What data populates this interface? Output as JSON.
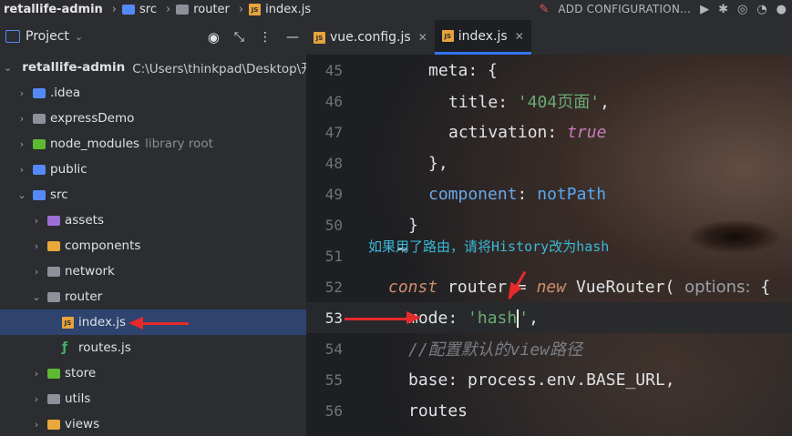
{
  "breadcrumb": {
    "project": "retallife-admin",
    "src": "src",
    "router": "router",
    "file": "index.js"
  },
  "toolbar": {
    "add_configuration": "ADD CONFIGURATION..."
  },
  "project_panel": {
    "title": "Project",
    "root": {
      "name": "retallife-admin",
      "path": "C:\\Users\\thinkpad\\Desktop\\开源"
    },
    "items": [
      {
        "name": ".idea"
      },
      {
        "name": "expressDemo"
      },
      {
        "name": "node_modules",
        "hint": "library root"
      },
      {
        "name": "public"
      },
      {
        "name": "src"
      },
      {
        "name": "assets"
      },
      {
        "name": "components"
      },
      {
        "name": "network"
      },
      {
        "name": "router"
      },
      {
        "name": "index.js"
      },
      {
        "name": "routes.js"
      },
      {
        "name": "store"
      },
      {
        "name": "utils"
      },
      {
        "name": "views"
      }
    ]
  },
  "tabs": [
    {
      "label": "vue.config.js"
    },
    {
      "label": "index.js"
    }
  ],
  "editor": {
    "line_numbers": [
      "45",
      "46",
      "47",
      "48",
      "49",
      "50",
      "51",
      "52",
      "53",
      "54",
      "55",
      "56"
    ],
    "tokens": {
      "meta": "meta",
      "title": "title",
      "title_value": "'404页面'",
      "activation": "activation",
      "true": "true",
      "component": "component",
      "notPath": "notPath",
      "const": "const",
      "router": "router",
      "new": "new",
      "VueRouter": "VueRouter",
      "options_hint": "options:",
      "mode": "mode",
      "hash_a": "'hash",
      "hash_b": "'",
      "comment": "//配置默认的view路径",
      "base": "base",
      "base_value": "process.env.BASE_URL",
      "routes": "routes"
    }
  },
  "annotation": "如果用了路由，请将History改为hash",
  "colors": {
    "annotation": "#3ab8d8",
    "arrow": "#e62a2a",
    "selection": "#2e436e",
    "tab_accent": "#3574f0"
  }
}
